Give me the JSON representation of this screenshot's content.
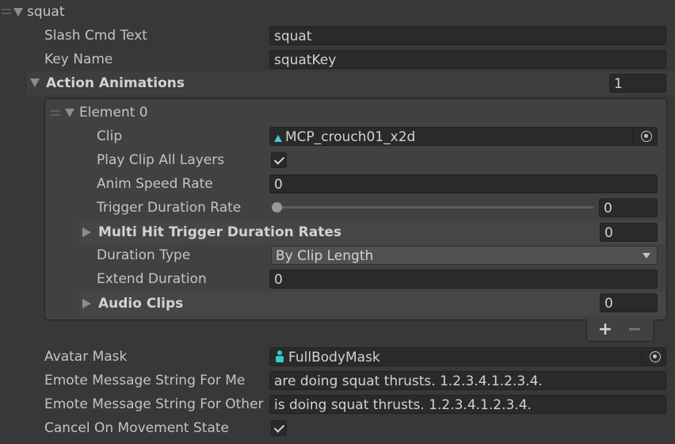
{
  "root": {
    "label": "squat"
  },
  "slash_cmd_text": {
    "label": "Slash Cmd Text",
    "value": "squat"
  },
  "key_name": {
    "label": "Key Name",
    "value": "squatKey"
  },
  "action_animations": {
    "label": "Action Animations",
    "count": "1",
    "element0": {
      "label": "Element 0",
      "clip": {
        "label": "Clip",
        "value": "MCP_crouch01_x2d",
        "icon": "animation-clip-icon"
      },
      "play_clip_all_layers": {
        "label": "Play Clip All Layers",
        "checked": true
      },
      "anim_speed_rate": {
        "label": "Anim Speed Rate",
        "value": "0"
      },
      "trigger_duration_rate": {
        "label": "Trigger Duration Rate",
        "value": "0",
        "slider_level": 0
      },
      "multi_hit": {
        "label": "Multi Hit Trigger Duration Rates",
        "count": "0"
      },
      "duration_type": {
        "label": "Duration Type",
        "value": "By Clip Length"
      },
      "extend_duration": {
        "label": "Extend Duration",
        "value": "0"
      },
      "audio_clips": {
        "label": "Audio Clips",
        "count": "0"
      }
    },
    "footer": {
      "add": "+",
      "remove": "−"
    }
  },
  "avatar_mask": {
    "label": "Avatar Mask",
    "value": "FullBodyMask",
    "icon": "avatar-mask-icon"
  },
  "emote_me": {
    "label": "Emote Message String For Me",
    "value": "are doing squat thrusts. 1.2.3.4.1.2.3.4."
  },
  "emote_other": {
    "label": "Emote Message String For Other",
    "value": "is doing squat thrusts. 1.2.3.4.1.2.3.4."
  },
  "cancel_on_movement": {
    "label": "Cancel On Movement State",
    "checked": true
  },
  "colors": {
    "background": "#383838",
    "field": "#2a2a2a",
    "text": "#c4c4c4",
    "accent_icon": "#4cc3d6"
  }
}
